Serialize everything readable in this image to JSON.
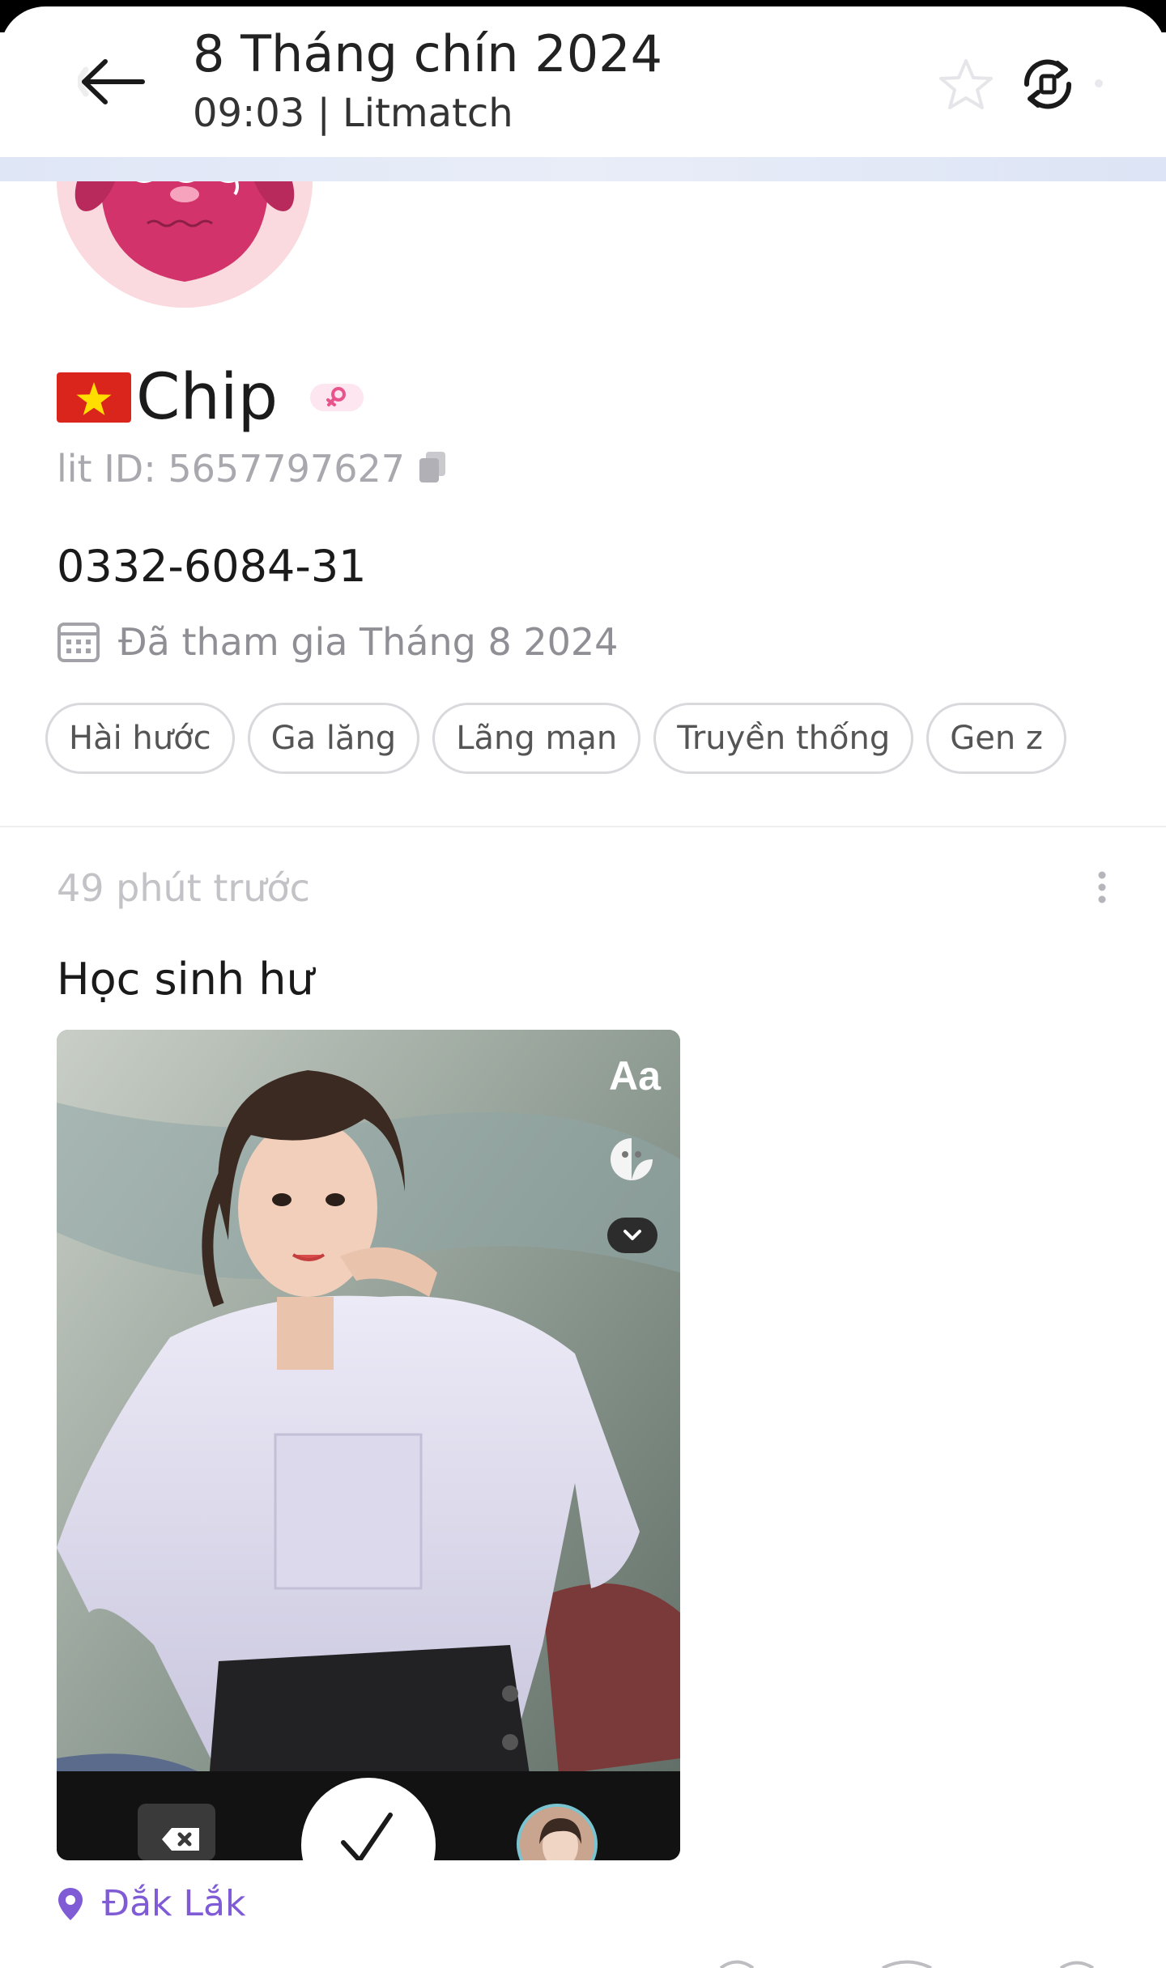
{
  "header": {
    "title": "8 Tháng chín 2024",
    "subtitle": "09:03 | Litmatch",
    "icons": [
      "back-arrow-icon",
      "star-icon",
      "sync-icon"
    ]
  },
  "profile": {
    "flag": "vietnam-flag-icon",
    "name": "Chip",
    "gender_badge": "female-icon",
    "lit_id": "lit ID: 5657797627",
    "bio": "0332-6084-31",
    "joined": "Đã tham gia Tháng 8 2024",
    "tags": [
      "Hài hước",
      "Ga lăng",
      "Lãng mạn",
      "Truyền thống",
      "Gen z"
    ]
  },
  "post": {
    "time_ago": "49 phút trước",
    "text": "Học sinh hư",
    "photo_overlay": {
      "text_tool": "Aa",
      "icons": [
        "sticker-icon",
        "chevron-down-icon",
        "delete-icon",
        "check-icon"
      ]
    },
    "location": "Đắk Lắk"
  },
  "colors": {
    "accent": "#7f5bd6",
    "avatar_bg": "#fadadf",
    "avatar_face": "#d1336a",
    "muted_text": "#a8a8ae",
    "tag_border": "#d9d9dd"
  }
}
